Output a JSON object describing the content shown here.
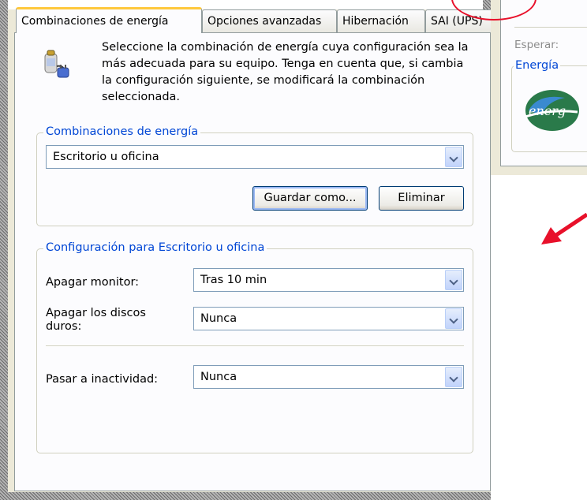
{
  "tabs": [
    {
      "label": "Combinaciones de energía",
      "active": true
    },
    {
      "label": "Opciones avanzadas",
      "active": false
    },
    {
      "label": "Hibernación",
      "active": false
    },
    {
      "label": "SAI (UPS)",
      "active": false
    }
  ],
  "intro_text": "Seleccione la combinación de energía  cuya configuración sea la más adecuada para su equipo. Tenga en cuenta que, si cambia la configuración siguiente, se modificará la combinación seleccionada.",
  "schemes_group": {
    "legend": "Combinaciones de energía",
    "selected": "Escritorio u oficina",
    "save_as_label": "Guardar como...",
    "delete_label": "Eliminar"
  },
  "settings_group": {
    "legend": "Configuración para Escritorio u oficina",
    "monitor_label": "Apagar monitor:",
    "monitor_value": "Tras 10 min",
    "disks_label": "Apagar los discos duros:",
    "disks_value": "Nunca",
    "standby_label": "Pasar a inactividad:",
    "standby_value": "Nunca"
  },
  "right_window": {
    "wait_label": "Esperar:",
    "energy_legend": "Energía"
  },
  "colors": {
    "accent_blue": "#0046d5",
    "annotation_red": "#e8102a",
    "dialog_face": "#ece9d8",
    "active_tab_highlight": "#ffc83c"
  },
  "icons": [
    "power-scheme-icon",
    "energy-star-logo",
    "annotation-arrow-icon"
  ]
}
